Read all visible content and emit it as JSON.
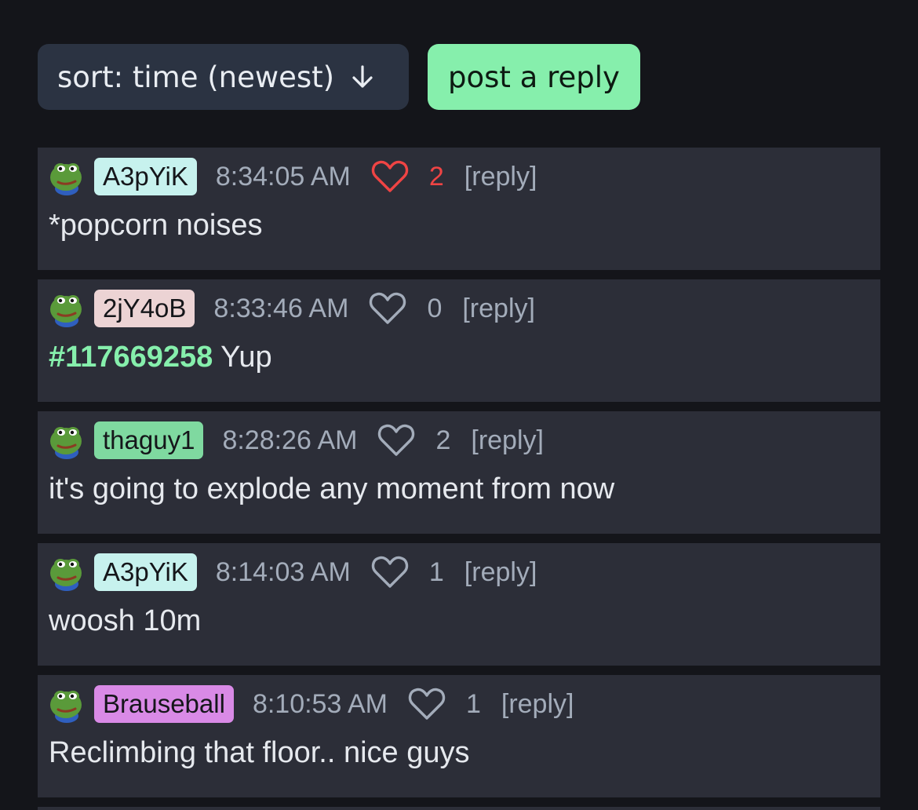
{
  "toolbar": {
    "sort_label": "sort: time (newest)",
    "sort_icon": "arrow-down-icon",
    "post_reply_label": "post a reply",
    "post_reply_color": "#86efac"
  },
  "comments": [
    {
      "username": "A3pYiK",
      "username_bg": "#c7f2ee",
      "time": "8:34:05 AM",
      "liked": true,
      "likes": "2",
      "reply_label": "[reply]",
      "ref": "",
      "text": "*popcorn noises"
    },
    {
      "username": "2jY4oB",
      "username_bg": "#ecd3d4",
      "time": "8:33:46 AM",
      "liked": false,
      "likes": "0",
      "reply_label": "[reply]",
      "ref": "#117669258",
      "text": " Yup"
    },
    {
      "username": "thaguy1",
      "username_bg": "#7fd9a0",
      "time": "8:28:26 AM",
      "liked": false,
      "likes": "2",
      "reply_label": "[reply]",
      "ref": "",
      "text": "it's going to explode any moment from now"
    },
    {
      "username": "A3pYiK",
      "username_bg": "#c7f2ee",
      "time": "8:14:03 AM",
      "liked": false,
      "likes": "1",
      "reply_label": "[reply]",
      "ref": "",
      "text": "woosh 10m"
    },
    {
      "username": "Brauseball",
      "username_bg": "#d98ae6",
      "time": "8:10:53 AM",
      "liked": false,
      "likes": "1",
      "reply_label": "[reply]",
      "ref": "",
      "text": "Reclimbing that floor.. nice guys"
    }
  ],
  "colors": {
    "background": "#14151a",
    "card": "#2c2e38",
    "liked_heart": "#ef4444",
    "heart": "#a3acba",
    "ref_link": "#86efac"
  }
}
